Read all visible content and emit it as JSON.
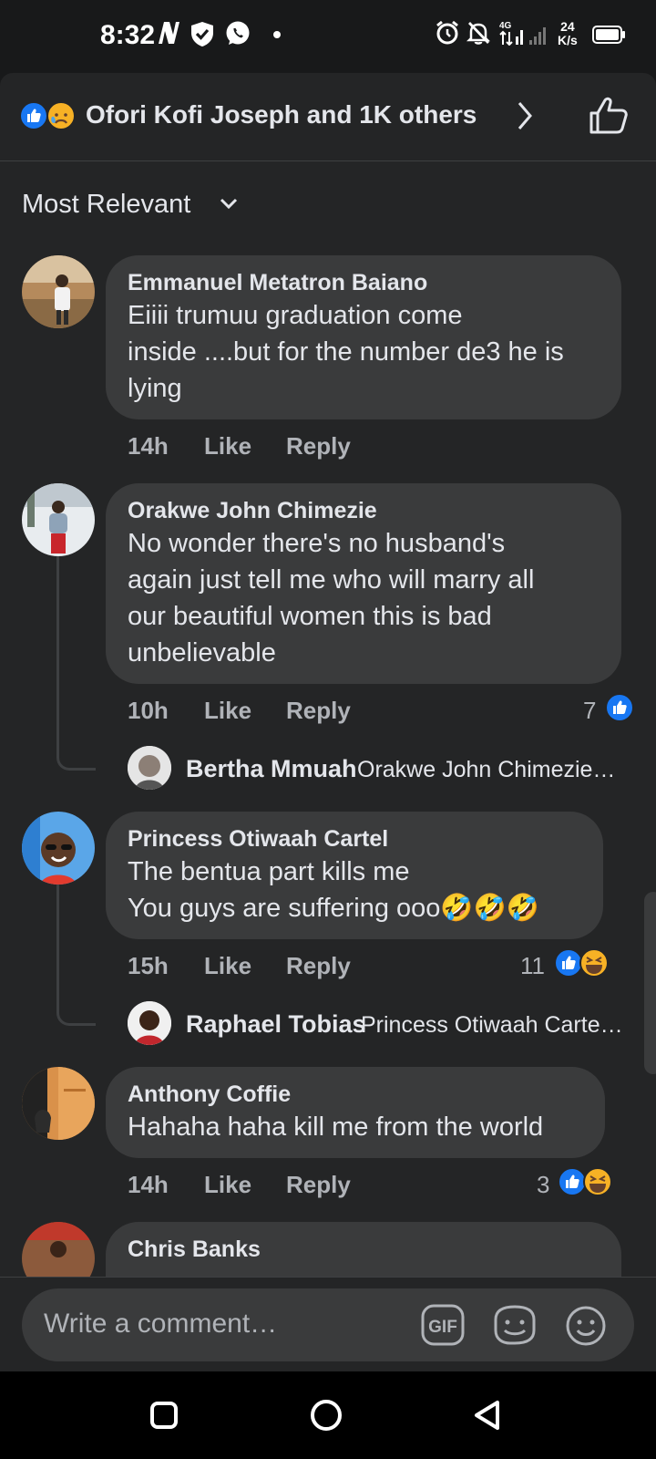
{
  "status_bar": {
    "time": "8:32",
    "network_speed_value": "24",
    "network_speed_unit": "K/s",
    "network_type": "4G"
  },
  "reactions_header": {
    "summary": "Ofori Kofi Joseph and 1K others"
  },
  "sort": {
    "label": "Most Relevant"
  },
  "actions": {
    "like": "Like",
    "reply": "Reply"
  },
  "comments": [
    {
      "name": "Emmanuel Metatron Baiano",
      "text": "Eiiii trumuu graduation come\ninside ....but for the number de3 he is\nlying",
      "time": "14h"
    },
    {
      "name": "Orakwe John Chimezie",
      "text": "No wonder there's no husband's\nagain just tell me who will marry all\nour beautiful women this is bad\nunbelievable",
      "time": "10h",
      "reaction_count": "7",
      "reply": {
        "name": "Bertha Mmuah",
        "preview": "Orakwe John Chimezie…"
      }
    },
    {
      "name": "Princess  Otiwaah Cartel",
      "text": "The bentua part kills me\nYou guys are suffering ooo🤣🤣🤣",
      "time": "15h",
      "reaction_count": "11",
      "reply": {
        "name": "Raphael Tobias",
        "preview": "Princess  Otiwaah Carte…"
      }
    },
    {
      "name": "Anthony Coffie",
      "text": "Hahaha haha kill me from the world",
      "time": "14h",
      "reaction_count": "3"
    },
    {
      "name": "Chris Banks"
    }
  ],
  "composer": {
    "placeholder": "Write a comment…",
    "gif_label": "GIF"
  },
  "colors": {
    "facebook_blue": "#1877f2",
    "sheet_bg": "#242526",
    "bubble_bg": "#3a3b3c",
    "secondary_text": "#b0b3b8"
  }
}
